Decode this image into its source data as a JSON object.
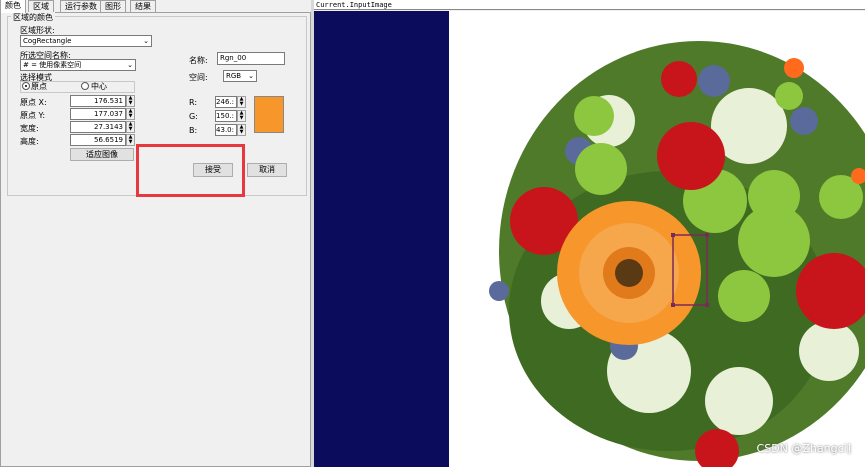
{
  "tabs": [
    {
      "label": "颜色",
      "active": true
    },
    {
      "label": "区域",
      "active": false
    },
    {
      "label": "运行参数",
      "active": false
    },
    {
      "label": "图形",
      "active": false
    },
    {
      "label": "结果",
      "active": false
    }
  ],
  "region_group": {
    "legend": "区域的颜色",
    "shape_label": "区域形状:",
    "shape_value": "CogRectangle",
    "space_name_label": "所选空间名称:",
    "space_name_value": "# = 使用像素空间",
    "mode_label": "选择模式",
    "mode_origin": "原点",
    "mode_center": "中心",
    "origin_x_label": "原点 X:",
    "origin_x_value": "176.531",
    "origin_y_label": "原点 Y:",
    "origin_y_value": "177.037",
    "width_label": "宽度:",
    "width_value": "27.3143",
    "height_label": "高度:",
    "height_value": "56.6519",
    "fit_image_button": "适应图像"
  },
  "color": {
    "name_label": "名称:",
    "name_value": "Rgn_00",
    "space_label": "空间:",
    "space_value": "RGB",
    "r_label": "R:",
    "r_value": "246.:",
    "g_label": "G:",
    "g_value": "150.:",
    "b_label": "B:",
    "b_value": "43.0:",
    "swatch": "#f7962b"
  },
  "buttons": {
    "accept": "接受",
    "cancel": "取消"
  },
  "image": {
    "title": "Current.InputImage",
    "watermark": "CSDN @Zhangci]"
  },
  "colors": {
    "highlight": "#e8383d",
    "navy": "#0c0c5c"
  }
}
